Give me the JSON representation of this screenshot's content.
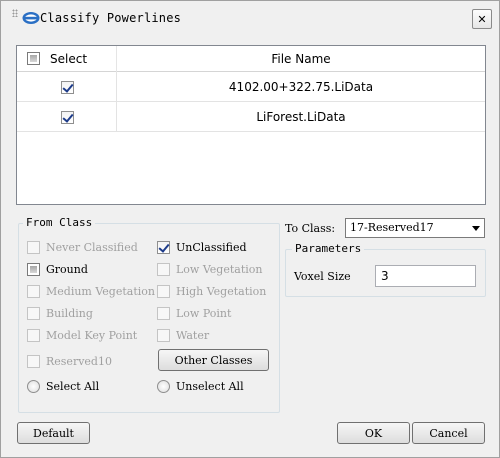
{
  "window": {
    "title": "Classify Powerlines",
    "close_glyph": "✕"
  },
  "table": {
    "headers": {
      "select": "Select",
      "file_name": "File Name"
    },
    "rows": [
      {
        "checked": true,
        "file_name": "4102.00+322.75.LiData"
      },
      {
        "checked": true,
        "file_name": "LiForest.LiData"
      }
    ]
  },
  "from_class": {
    "title": "From Class",
    "options": [
      {
        "label": "Never Classified",
        "checked": false,
        "enabled": false
      },
      {
        "label": "UnClassified",
        "checked": true,
        "enabled": true
      },
      {
        "label": "Ground",
        "checked": false,
        "enabled": true
      },
      {
        "label": "Low Vegetation",
        "checked": false,
        "enabled": false
      },
      {
        "label": "Medium Vegetation",
        "checked": false,
        "enabled": false
      },
      {
        "label": "High Vegetation",
        "checked": false,
        "enabled": false
      },
      {
        "label": "Building",
        "checked": false,
        "enabled": false
      },
      {
        "label": "Low Point",
        "checked": false,
        "enabled": false
      },
      {
        "label": "Model Key Point",
        "checked": false,
        "enabled": false
      },
      {
        "label": "Water",
        "checked": false,
        "enabled": false
      },
      {
        "label": "Reserved10",
        "checked": false,
        "enabled": false
      }
    ],
    "other_classes_button": "Other Classes",
    "select_all": "Select All",
    "unselect_all": "Unselect All"
  },
  "to_class": {
    "label": "To Class:",
    "selected": "17-Reserved17"
  },
  "parameters": {
    "title": "Parameters",
    "voxel_size_label": "Voxel Size",
    "voxel_size_value": "3"
  },
  "buttons": {
    "default": "Default",
    "ok": "OK",
    "cancel": "Cancel"
  },
  "colors": {
    "window_bg": "#f0f0f0",
    "check_mark": "#1e3c8a",
    "disabled_text": "#a0a0a0"
  }
}
